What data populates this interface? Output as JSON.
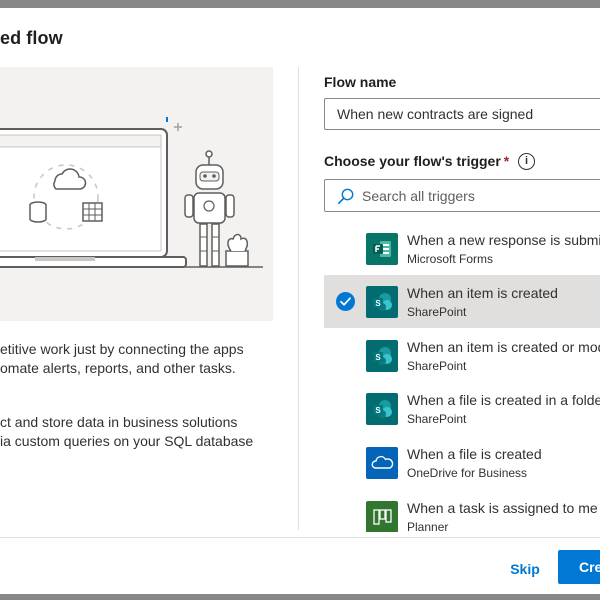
{
  "dialog": {
    "title": "ed flow",
    "description_1": [
      "etitive work just by connecting the apps",
      "omate alerts, reports, and other tasks."
    ],
    "description_2": [
      "ct and store data in business solutions",
      "ia custom queries on your SQL database"
    ]
  },
  "form": {
    "flow_name_label": "Flow name",
    "flow_name_value": "When new contracts are signed",
    "trigger_label": "Choose your flow's trigger",
    "required_marker": "*",
    "info_glyph": "i",
    "search_placeholder": "Search all triggers"
  },
  "triggers": [
    {
      "title": "When a new response is submitted",
      "connector": "Microsoft Forms",
      "icon": "forms-icon",
      "color": "#077568",
      "selected": false
    },
    {
      "title": "When an item is created",
      "connector": "SharePoint",
      "icon": "sharepoint-icon",
      "color": "#036c70",
      "selected": true
    },
    {
      "title": "When an item is created or modified",
      "connector": "SharePoint",
      "icon": "sharepoint-icon",
      "color": "#036c70",
      "selected": false
    },
    {
      "title": "When a file is created in a folder",
      "connector": "SharePoint",
      "icon": "sharepoint-icon",
      "color": "#036c70",
      "selected": false
    },
    {
      "title": "When a file is created",
      "connector": "OneDrive for Business",
      "icon": "onedrive-icon",
      "color": "#0364b8",
      "selected": false
    },
    {
      "title": "When a task is assigned to me",
      "connector": "Planner",
      "icon": "planner-icon",
      "color": "#31752f",
      "selected": false
    }
  ],
  "footer": {
    "skip_label": "Skip",
    "create_label": "Create"
  },
  "colors": {
    "accent": "#0078d4",
    "selected_row": "#e1dfdd",
    "required": "#a4262c"
  }
}
